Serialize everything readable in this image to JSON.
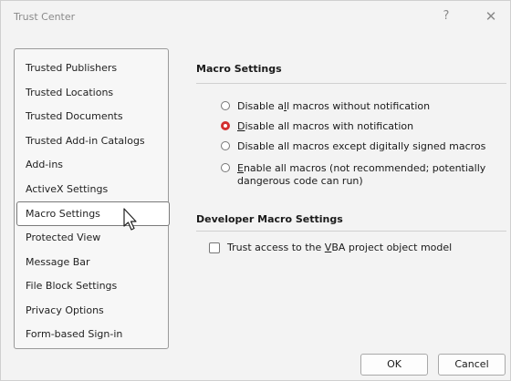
{
  "window": {
    "title": "Trust Center",
    "help_glyph": "?",
    "close_glyph": "✕"
  },
  "nav": {
    "items": [
      {
        "label": "Trusted Publishers"
      },
      {
        "label": "Trusted Locations"
      },
      {
        "label": "Trusted Documents"
      },
      {
        "label": "Trusted Add-in Catalogs"
      },
      {
        "label": "Add-ins"
      },
      {
        "label": "ActiveX Settings"
      },
      {
        "label": "Macro Settings",
        "selected": true
      },
      {
        "label": "Protected View"
      },
      {
        "label": "Message Bar"
      },
      {
        "label": "File Block Settings"
      },
      {
        "label": "Privacy Options"
      },
      {
        "label": "Form-based Sign-in"
      }
    ]
  },
  "macro_settings": {
    "title": "Macro Settings",
    "options": [
      {
        "pre": "Disable a",
        "accel": "l",
        "post": "l macros without notification",
        "checked": false
      },
      {
        "pre": "",
        "accel": "D",
        "post": "isable all macros with notification",
        "checked": true
      },
      {
        "pre": "Disable all macros except digitally signed macros",
        "accel": "",
        "post": "",
        "checked": false
      },
      {
        "pre": "",
        "accel": "E",
        "post": "nable all macros (not recommended; potentially",
        "line2": "dangerous code can run)",
        "checked": false
      }
    ]
  },
  "developer_settings": {
    "title": "Developer Macro Settings",
    "vba_pre": "Trust access to the ",
    "vba_accel": "V",
    "vba_post": "BA project object model",
    "vba_checked": false
  },
  "buttons": {
    "ok": "OK",
    "cancel": "Cancel"
  },
  "colors": {
    "accent_radio": "#d32f2f",
    "background": "#f3f3f3"
  }
}
